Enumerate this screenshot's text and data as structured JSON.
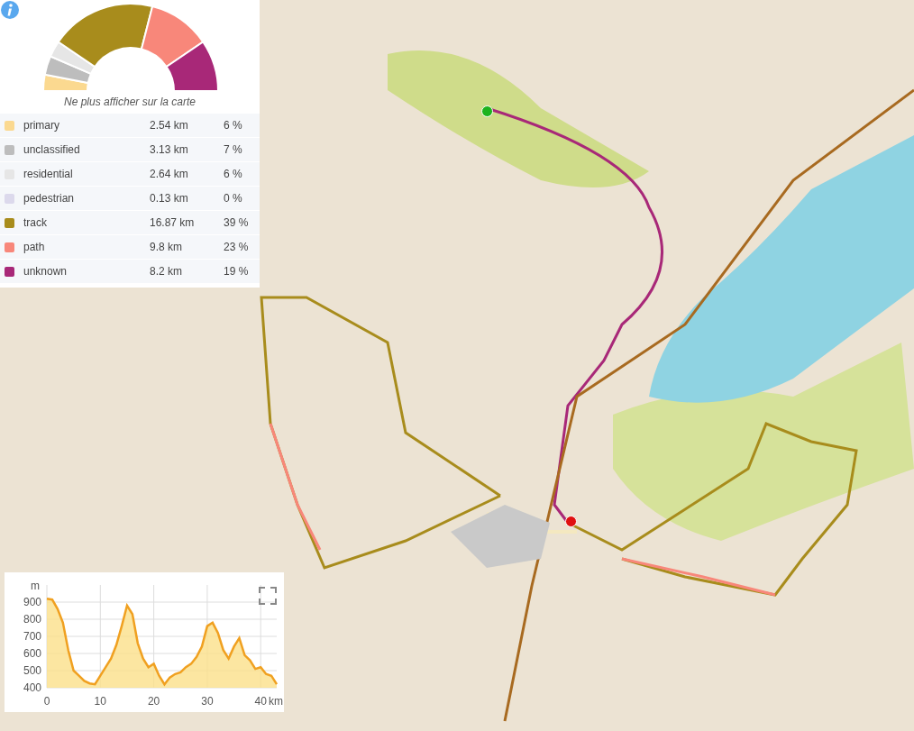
{
  "surface_chart": {
    "chart_data": {
      "type": "donut",
      "categories": [
        "primary",
        "unclassified",
        "residential",
        "pedestrian",
        "track",
        "path",
        "unknown"
      ],
      "values": [
        6,
        7,
        6,
        0,
        39,
        23,
        19
      ]
    }
  },
  "hide_link": "Ne plus afficher sur la carte",
  "legend": [
    {
      "distance": "2.54 km",
      "percent": "6 %",
      "color": "#fbd990"
    },
    {
      "distance": "3.13 km",
      "percent": "7 %",
      "color": "#bdbdbd"
    },
    {
      "distance": "2.64 km",
      "percent": "6 %",
      "color": "#e6e6e6"
    },
    {
      "distance": "0.13 km",
      "percent": "0 %",
      "color": "#dcd9ec"
    },
    {
      "distance": "16.87 km",
      "percent": "39 %",
      "color": "#a88c1c"
    },
    {
      "distance": "9.8 km",
      "percent": "23 %",
      "color": "#f8877a"
    },
    {
      "distance": "8.2 km",
      "percent": "19 %",
      "color": "#a82878"
    }
  ],
  "elevation": {
    "chart_data": {
      "type": "area",
      "xlabel": "km",
      "ylabel": "m",
      "x": [
        0,
        1,
        2,
        3,
        4,
        5,
        6,
        7,
        8,
        9,
        10,
        11,
        12,
        13,
        14,
        15,
        16,
        17,
        18,
        19,
        20,
        21,
        22,
        23,
        24,
        25,
        26,
        27,
        28,
        29,
        30,
        31,
        32,
        33,
        34,
        35,
        36,
        37,
        38,
        39,
        40,
        41,
        42,
        43
      ],
      "values": [
        920,
        915,
        860,
        780,
        620,
        500,
        470,
        440,
        425,
        420,
        470,
        520,
        570,
        650,
        760,
        880,
        830,
        660,
        570,
        520,
        540,
        470,
        420,
        460,
        480,
        490,
        520,
        540,
        580,
        640,
        760,
        780,
        720,
        620,
        570,
        640,
        690,
        590,
        560,
        510,
        520,
        480,
        470,
        420
      ],
      "xlim": [
        0,
        43
      ],
      "ylim": [
        400,
        1000
      ],
      "grid": true,
      "xticks": [
        0,
        10,
        20,
        30,
        40
      ],
      "yticks": [
        400,
        500,
        600,
        700,
        800,
        900
      ]
    }
  }
}
